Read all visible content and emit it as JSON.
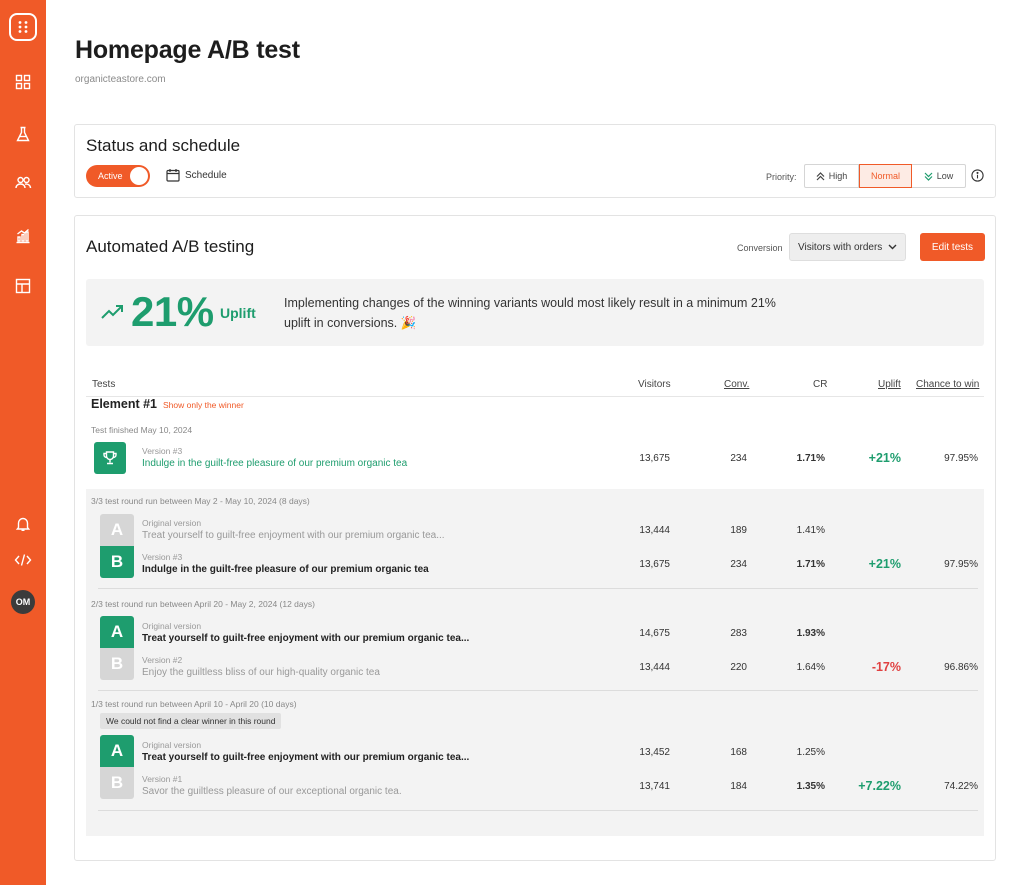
{
  "sidebar": {
    "avatar_initials": "OM",
    "icons": [
      "app-logo-icon",
      "dashboard-icon",
      "flask-icon",
      "users-icon",
      "analytics-icon",
      "layout-icon",
      "bell-icon",
      "code-icon"
    ]
  },
  "header": {
    "title": "Homepage A/B test",
    "subtitle": "organicteastore.com"
  },
  "status": {
    "title": "Status and schedule",
    "toggle_label": "Active",
    "schedule_label": "Schedule",
    "priority_label": "Priority:",
    "priority_options": [
      "High",
      "Normal",
      "Low"
    ],
    "priority_selected": "Normal"
  },
  "auto": {
    "title": "Automated A/B testing",
    "conversion_label": "Conversion",
    "conversion_value": "Visitors with orders",
    "edit_button": "Edit tests",
    "uplift_value": "21%",
    "uplift_word": "Uplift",
    "uplift_description": "Implementing changes of the winning variants would most likely result in a minimum 21% uplift in conversions. 🎉"
  },
  "table": {
    "headers": {
      "tests": "Tests",
      "visitors": "Visitors",
      "conv": "Conv.",
      "cr": "CR",
      "uplift": "Uplift",
      "chance": "Chance to win"
    },
    "element_title": "Element #1",
    "show_winner_link": "Show only the winner",
    "finished_text": "Test finished May 10, 2024",
    "winner": {
      "label": "Version #3",
      "text": "Indulge in the guilt-free pleasure of our premium organic tea",
      "visitors": "13,675",
      "conv": "234",
      "cr": "1.71%",
      "uplift": "+21%",
      "chance": "97.95%"
    },
    "rounds": [
      {
        "title": "3/3 test round run between May 2 - May 10, 2024 (8 days)",
        "a": {
          "letter": "A",
          "label": "Original version",
          "text": "Treat yourself to guilt-free enjoyment with our premium organic tea...",
          "visitors": "13,444",
          "conv": "189",
          "cr": "1.41%",
          "uplift": "",
          "chance": ""
        },
        "b": {
          "letter": "B",
          "label": "Version #3",
          "text": "Indulge in the guilt-free pleasure of our premium organic tea",
          "visitors": "13,675",
          "conv": "234",
          "cr": "1.71%",
          "uplift": "+21%",
          "chance": "97.95%"
        }
      },
      {
        "title": "2/3 test round run between April 20 - May 2, 2024 (12 days)",
        "a": {
          "letter": "A",
          "label": "Original version",
          "text": "Treat yourself to guilt-free enjoyment with our premium organic tea...",
          "visitors": "14,675",
          "conv": "283",
          "cr": "1.93%",
          "uplift": "",
          "chance": ""
        },
        "b": {
          "letter": "B",
          "label": "Version #2",
          "text": "Enjoy the guiltless bliss of our high-quality organic tea",
          "visitors": "13,444",
          "conv": "220",
          "cr": "1.64%",
          "uplift": "-17%",
          "chance": "96.86%"
        }
      },
      {
        "title": "1/3 test round run between April 10 - April 20 (10 days)",
        "note": "We could not find a clear winner in this round",
        "a": {
          "letter": "A",
          "label": "Original version",
          "text": "Treat yourself to guilt-free enjoyment with our premium organic tea...",
          "visitors": "13,452",
          "conv": "168",
          "cr": "1.25%",
          "uplift": "",
          "chance": ""
        },
        "b": {
          "letter": "B",
          "label": "Version #1",
          "text": "Savor the guiltless pleasure of our exceptional organic tea.",
          "visitors": "13,741",
          "conv": "184",
          "cr": "1.35%",
          "uplift": "+7.22%",
          "chance": "74.22%"
        }
      }
    ]
  },
  "colors": {
    "brand": "#f05a28",
    "success": "#1e9d6e",
    "danger": "#e04040"
  }
}
